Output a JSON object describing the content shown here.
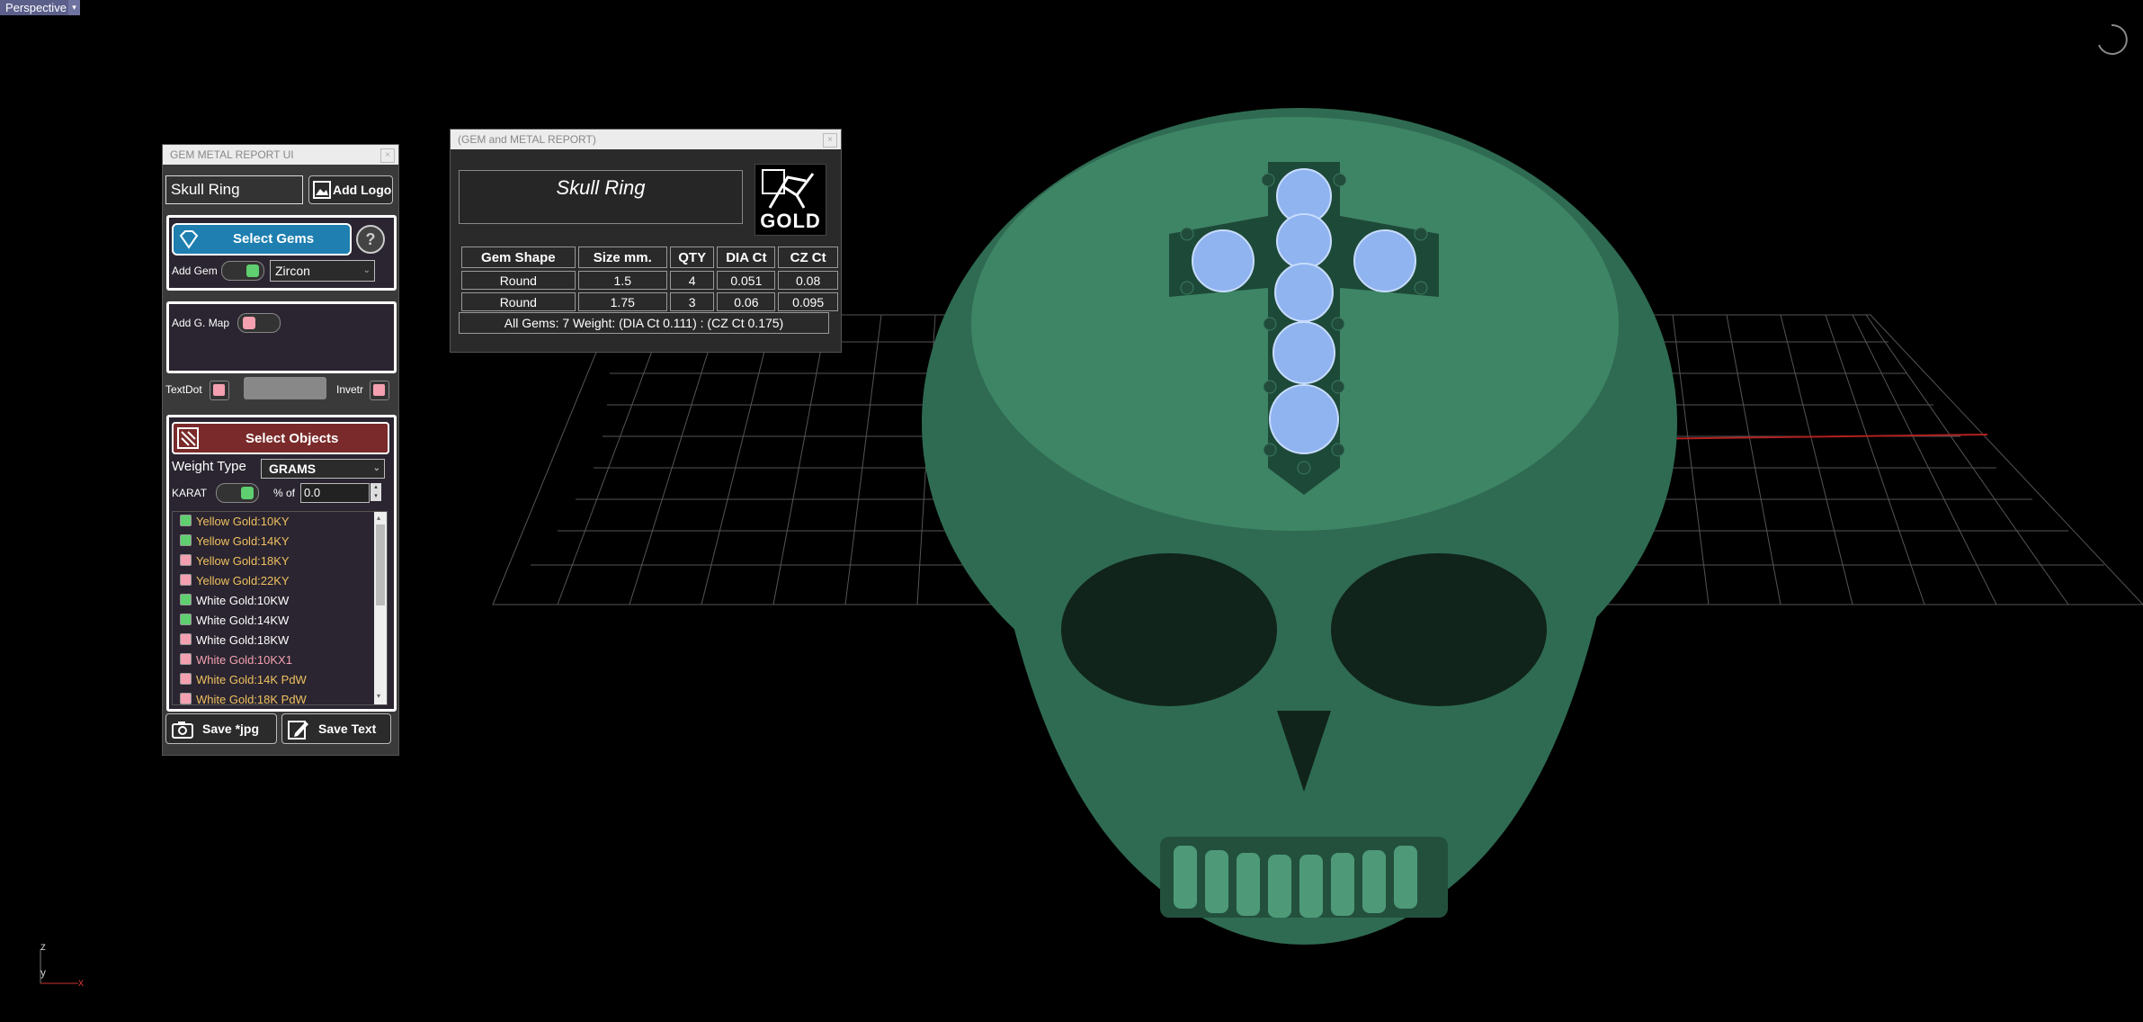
{
  "viewport": {
    "label": "Perspective",
    "dropdown_glyph": "▾"
  },
  "axis": {
    "z": "z",
    "y": "y",
    "x": "x"
  },
  "panel1": {
    "title": "GEM METAL REPORT UI",
    "name_value": "Skull Ring",
    "add_logo": "Add Logo",
    "select_gems": "Select Gems",
    "help": "?",
    "add_gem": "Add Gem",
    "gem_type": "Zircon",
    "add_gmap": "Add G. Map",
    "textdot": "TextDot",
    "invetr": "Invetr",
    "select_objects": "Select Objects",
    "weight_type_label": "Weight Type",
    "weight_type_value": "GRAMS",
    "karat": "KARAT",
    "percent_of": "% of",
    "percent_value": "0.0",
    "metals": [
      {
        "label": "Yellow Gold:10KY",
        "color": "#f0c060",
        "check": "#5fcf6f"
      },
      {
        "label": "Yellow Gold:14KY",
        "color": "#f0c060",
        "check": "#5fcf6f"
      },
      {
        "label": "Yellow Gold:18KY",
        "color": "#f0c060",
        "check": "#f4a0b0"
      },
      {
        "label": "Yellow Gold:22KY",
        "color": "#f0c060",
        "check": "#f4a0b0"
      },
      {
        "label": "White Gold:10KW",
        "color": "#ffffff",
        "check": "#5fcf6f"
      },
      {
        "label": "White Gold:14KW",
        "color": "#ffffff",
        "check": "#5fcf6f"
      },
      {
        "label": "White Gold:18KW",
        "color": "#ffffff",
        "check": "#f4a0b0"
      },
      {
        "label": "White Gold:10KX1",
        "color": "#f4a0b0",
        "check": "#f4a0b0"
      },
      {
        "label": "White Gold:14K PdW",
        "color": "#f0c060",
        "check": "#f4a0b0"
      },
      {
        "label": "White Gold:18K PdW",
        "color": "#f0c060",
        "check": "#f4a0b0"
      }
    ],
    "save_jpg": "Save *jpg",
    "save_text": "Save Text"
  },
  "panel2": {
    "title": "(GEM and METAL REPORT)",
    "name": "Skull Ring",
    "logo_text": "GOLD",
    "headers": [
      "Gem Shape",
      "Size mm.",
      "QTY",
      "DIA Ct",
      "CZ Ct"
    ],
    "rows": [
      [
        "Round",
        "1.5",
        "4",
        "0.051",
        "0.08"
      ],
      [
        "Round",
        "1.75",
        "3",
        "0.06",
        "0.095"
      ]
    ],
    "summary": "All Gems: 7  Weight: (DIA Ct 0.111) : (CZ Ct 0.175)"
  },
  "colors": {
    "skull": "#2f6b52",
    "gem": "#8fb4f0",
    "toggle_on": "#5fcf6f",
    "toggle_off": "#f4a0b0",
    "select_gems_bg": "#1e7fb0",
    "select_objects_bg": "#7a2a2a"
  }
}
